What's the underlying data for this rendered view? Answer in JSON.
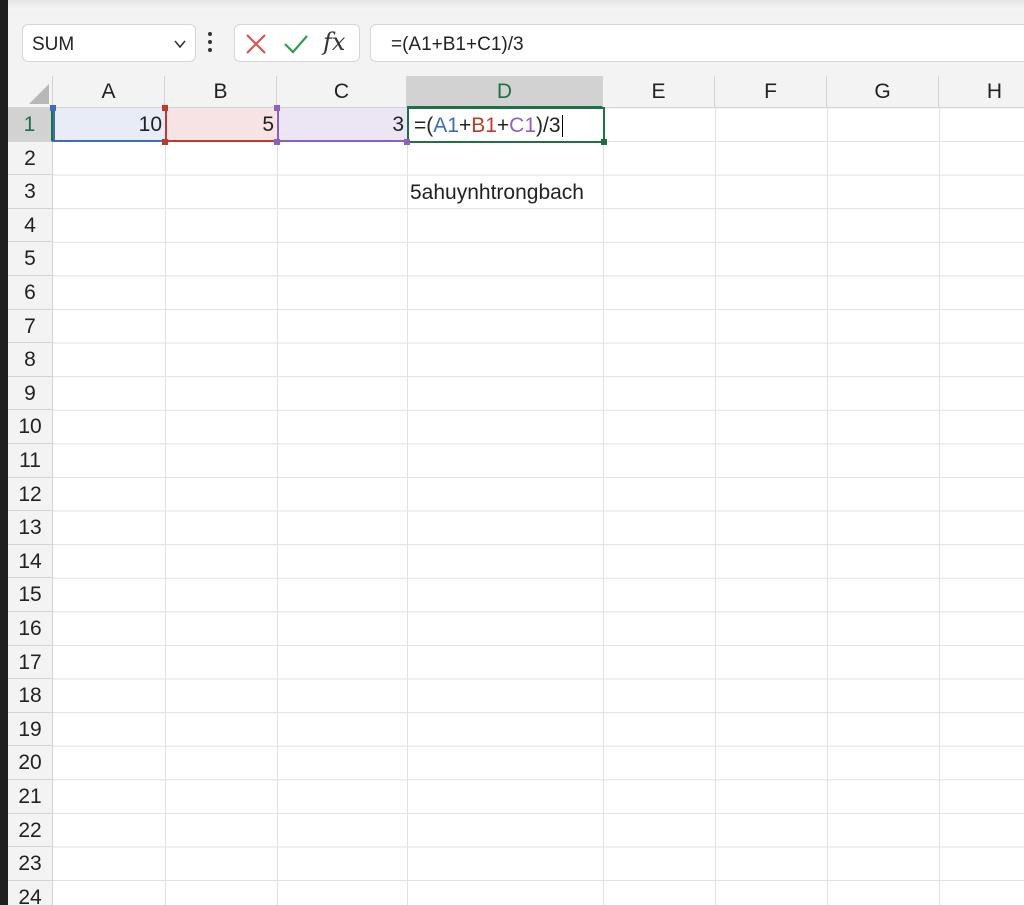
{
  "formula_bar": {
    "name_box": "SUM",
    "fx_label": "fx",
    "formula": "=(A1+B1+C1)/3"
  },
  "columns": [
    "A",
    "B",
    "C",
    "D",
    "E",
    "F",
    "G",
    "H"
  ],
  "rows": [
    "1",
    "2",
    "3",
    "4",
    "5",
    "6",
    "7",
    "8",
    "9",
    "10",
    "11",
    "12",
    "13",
    "14",
    "15",
    "16",
    "17",
    "18",
    "19",
    "20",
    "21",
    "22",
    "23",
    "24"
  ],
  "cells": {
    "A1": "10",
    "B1": "5",
    "C1": "3",
    "D1": {
      "prefix": "=(",
      "ref_a": "A1",
      "plus1": "+",
      "ref_b": "B1",
      "plus2": "+",
      "ref_c": "C1",
      "suffix": ")/3"
    },
    "D3": "5ahuynhtrongbach"
  },
  "colors": {
    "active_green": "#1e7145",
    "ref_blue": "#3d6cb8",
    "ref_red": "#c0392b",
    "ref_purple": "#8e5fc2",
    "cancel_red": "#d9534f",
    "enter_green": "#2e9e53"
  }
}
